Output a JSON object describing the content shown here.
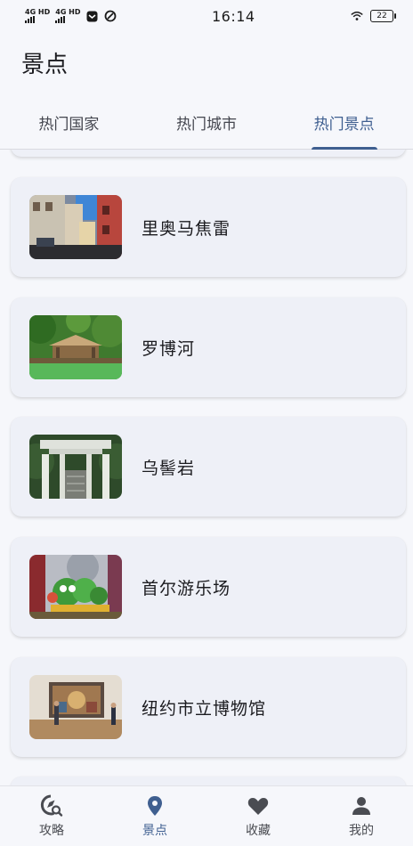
{
  "status_bar": {
    "network_1": "4G HD",
    "network_2": "4G HD",
    "time": "16:14",
    "battery": "22"
  },
  "app_bar": {
    "title": "景点"
  },
  "tabs": [
    {
      "label": "热门国家",
      "active": false
    },
    {
      "label": "热门城市",
      "active": false
    },
    {
      "label": "热门景点",
      "active": true
    }
  ],
  "attractions": [
    {
      "name": "里奥马焦雷",
      "image_icon": "street-photo"
    },
    {
      "name": "罗博河",
      "image_icon": "pavilion-photo"
    },
    {
      "name": "乌髻岩",
      "image_icon": "gate-photo"
    },
    {
      "name": "首尔游乐场",
      "image_icon": "amusement-photo"
    },
    {
      "name": "纽约市立博物馆",
      "image_icon": "museum-photo"
    }
  ],
  "bottom_nav": [
    {
      "label": "攻略",
      "icon": "compass-search-icon",
      "active": false
    },
    {
      "label": "景点",
      "icon": "location-pin-icon",
      "active": true
    },
    {
      "label": "收藏",
      "icon": "heart-icon",
      "active": false
    },
    {
      "label": "我的",
      "icon": "person-icon",
      "active": false
    }
  ],
  "colors": {
    "accent": "#3f5f90",
    "background": "#f6f7fb",
    "card": "#eef0f7"
  }
}
